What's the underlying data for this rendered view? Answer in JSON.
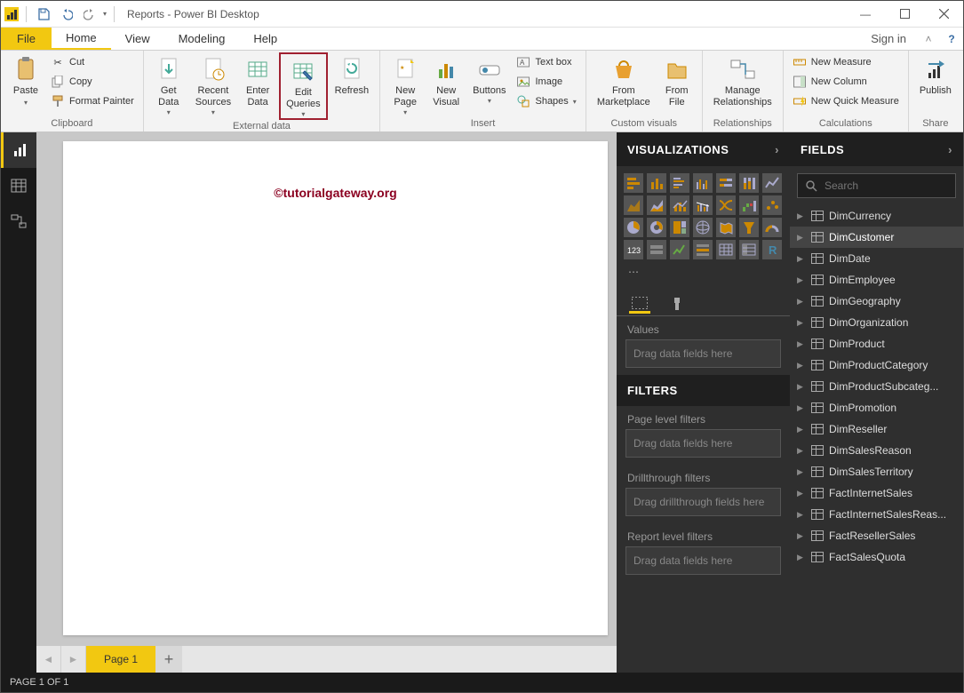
{
  "window": {
    "title": "Reports - Power BI Desktop"
  },
  "menu": {
    "file": "File",
    "tabs": [
      "Home",
      "View",
      "Modeling",
      "Help"
    ],
    "active": "Home",
    "signin": "Sign in"
  },
  "clipboard": {
    "paste": "Paste",
    "cut": "Cut",
    "copy": "Copy",
    "format_painter": "Format Painter",
    "group": "Clipboard"
  },
  "external": {
    "get_data": "Get\nData",
    "recent_sources": "Recent\nSources",
    "enter_data": "Enter\nData",
    "edit_queries": "Edit\nQueries",
    "refresh": "Refresh",
    "group": "External data"
  },
  "insert": {
    "new_page": "New\nPage",
    "new_visual": "New\nVisual",
    "buttons": "Buttons",
    "text_box": "Text box",
    "image": "Image",
    "shapes": "Shapes",
    "group": "Insert"
  },
  "custom": {
    "marketplace": "From\nMarketplace",
    "file": "From\nFile",
    "group": "Custom visuals"
  },
  "relationships": {
    "manage": "Manage\nRelationships",
    "group": "Relationships"
  },
  "calculations": {
    "new_measure": "New Measure",
    "new_column": "New Column",
    "new_quick": "New Quick Measure",
    "group": "Calculations"
  },
  "share": {
    "publish": "Publish",
    "group": "Share"
  },
  "watermark": "©tutorialgateway.org",
  "pages": {
    "tab": "Page 1"
  },
  "viz": {
    "title": "VISUALIZATIONS",
    "values": "Values",
    "drag1": "Drag data fields here",
    "filters_title": "FILTERS",
    "page_filters": "Page level filters",
    "drag2": "Drag data fields here",
    "drill": "Drillthrough filters",
    "drag3": "Drag drillthrough fields here",
    "report_filters": "Report level filters",
    "drag4": "Drag data fields here"
  },
  "fields": {
    "title": "FIELDS",
    "search_placeholder": "Search",
    "items": [
      "DimCurrency",
      "DimCustomer",
      "DimDate",
      "DimEmployee",
      "DimGeography",
      "DimOrganization",
      "DimProduct",
      "DimProductCategory",
      "DimProductSubcateg...",
      "DimPromotion",
      "DimReseller",
      "DimSalesReason",
      "DimSalesTerritory",
      "FactInternetSales",
      "FactInternetSalesReas...",
      "FactResellerSales",
      "FactSalesQuota"
    ],
    "selected": "DimCustomer"
  },
  "status": "PAGE 1 OF 1"
}
